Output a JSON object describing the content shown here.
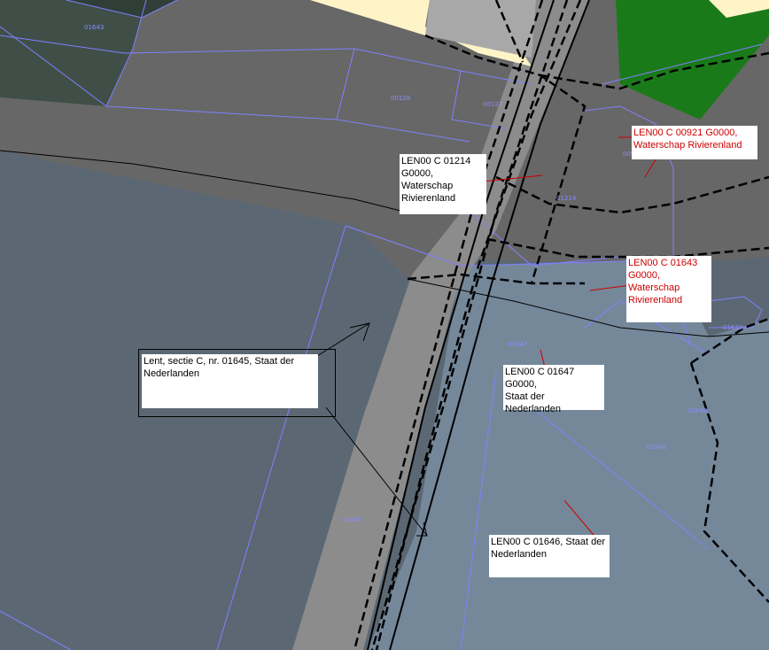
{
  "callouts": {
    "c01214": "LEN00 C 01214\nG0000,\nWaterschap\nRivierenland",
    "c00921": "LEN00 C 00921 G0000,\nWaterschap Rivierenland",
    "c01643": "LEN00 C 01643\nG0000,\nWaterschap\nRivierenland",
    "c01645": "Lent, sectie C, nr. 01645, Staat der\nNederlanden",
    "c01647": "LEN00 C 01647 G0000,\nStaat der Nederlanden",
    "c01646": "LEN00 C 01646, Staat der\nNederlanden"
  },
  "parcel_labels": {
    "p01643": "01643",
    "p00128": "00128",
    "p00127": "00127",
    "p01214": "01214",
    "p01647": "01647",
    "p01639": "01639",
    "p01646": "01646",
    "p01648": "01648",
    "p01645": "01645",
    "p009": "009"
  },
  "colors": {
    "lowland_gray": "#5b6874",
    "dark_parcel": "#676767",
    "road": "#8c8c8c",
    "green_parcel": "#1a7a1a",
    "dark_green": "#3f4f48",
    "light_blue_parcel": "#75889a",
    "boundary": "#8080ff",
    "red_leader": "#cc0000"
  }
}
